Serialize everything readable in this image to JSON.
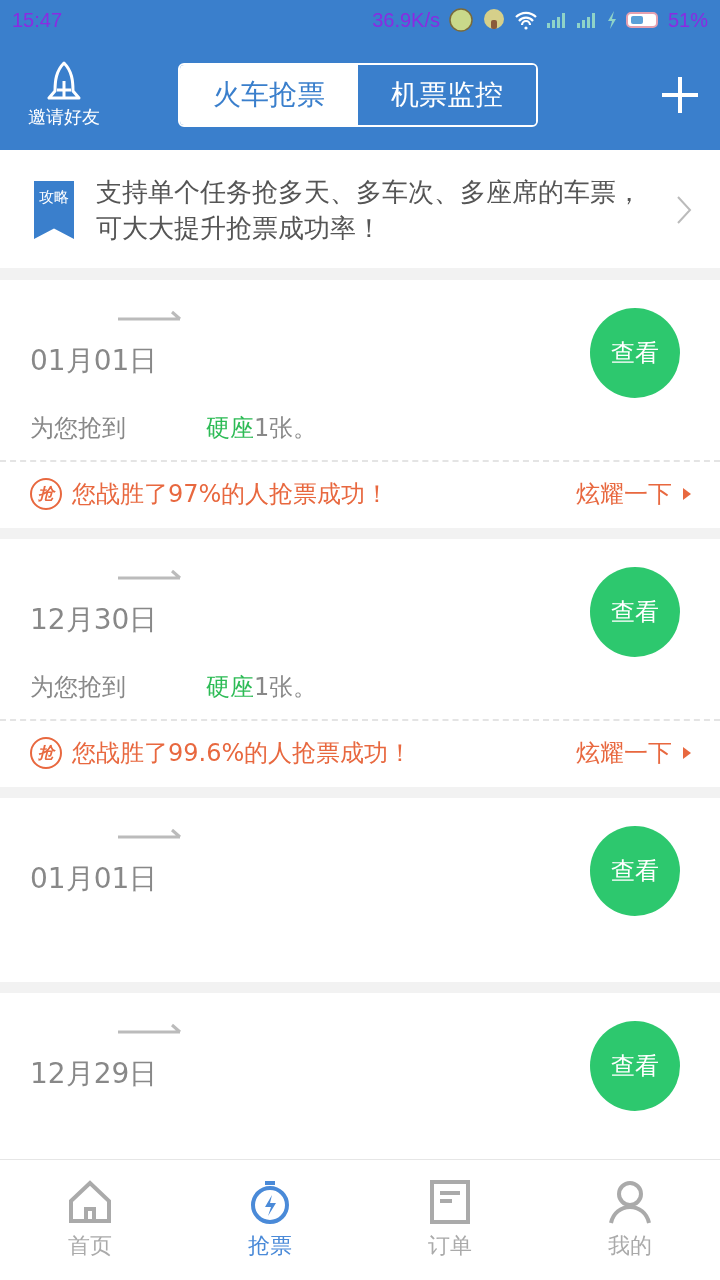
{
  "status_bar": {
    "time": "15:47",
    "speed": "36.9K/s",
    "battery_percent": "51%"
  },
  "header": {
    "invite_label": "邀请好友",
    "tabs": [
      {
        "label": "火车抢票",
        "selected": true
      },
      {
        "label": "机票监控",
        "selected": false
      }
    ]
  },
  "notice": {
    "badge": "攻略",
    "text": "支持单个任务抢多天、多车次、多座席的车票，可大大提升抢票成功率！"
  },
  "tasks": [
    {
      "date": "01月01日",
      "button": "查看",
      "message": {
        "prefix": "为您抢到",
        "seat": "硬座",
        "suffix": "1张。"
      },
      "footer": {
        "badge": "抢",
        "text": "您战胜了97%的人抢票成功！",
        "action": "炫耀一下"
      }
    },
    {
      "date": "12月30日",
      "button": "查看",
      "message": {
        "prefix": "为您抢到",
        "seat": "硬座",
        "suffix": "1张。"
      },
      "footer": {
        "badge": "抢",
        "text": "您战胜了99.6%的人抢票成功！",
        "action": "炫耀一下"
      }
    },
    {
      "date": "01月01日",
      "button": "查看"
    },
    {
      "date": "12月29日",
      "button": "查看"
    }
  ],
  "bottom_nav": [
    {
      "label": "首页",
      "selected": false
    },
    {
      "label": "抢票",
      "selected": true
    },
    {
      "label": "订单",
      "selected": false
    },
    {
      "label": "我的",
      "selected": false
    }
  ]
}
